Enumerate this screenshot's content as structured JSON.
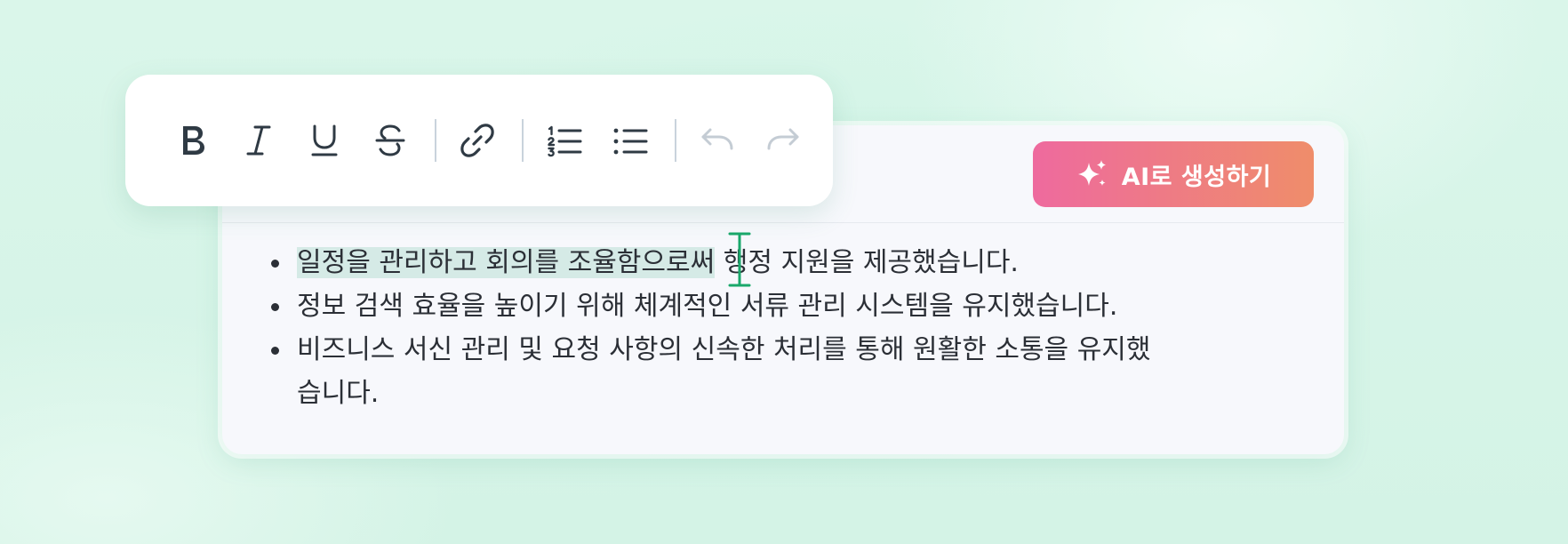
{
  "toolbar": {
    "buttons": [
      {
        "name": "bold-icon"
      },
      {
        "name": "italic-icon"
      },
      {
        "name": "underline-icon"
      },
      {
        "name": "strikethrough-icon"
      },
      {
        "name": "link-icon"
      },
      {
        "name": "ordered-list-icon"
      },
      {
        "name": "bullet-list-icon"
      },
      {
        "name": "undo-icon",
        "disabled": true
      },
      {
        "name": "redo-icon",
        "disabled": true
      }
    ],
    "icon_color": "#2f3a44",
    "disabled_color": "#c4ccd4"
  },
  "ai_button": {
    "label": "AI로 생성하기",
    "icon": "sparkle-icon",
    "gradient_start": "#ee6a9e",
    "gradient_end": "#ef8d6a"
  },
  "editor": {
    "items": [
      {
        "selected_text": "일정을 관리하고 회의를 조율함으로써",
        "rest_text": " 행정 지원을 제공했습니다."
      },
      {
        "text": "정보 검색 효율을 높이기 위해 체계적인 서류 관리 시스템을 유지했습니다."
      },
      {
        "text": "비즈니스 서신 관리 및 요청 사항의 신속한 처리를 통해 원활한 소통을 유지했",
        "text_cont": "습니다."
      }
    ],
    "caret_color": "#1aa86b",
    "selection_color": "#96d2be"
  }
}
